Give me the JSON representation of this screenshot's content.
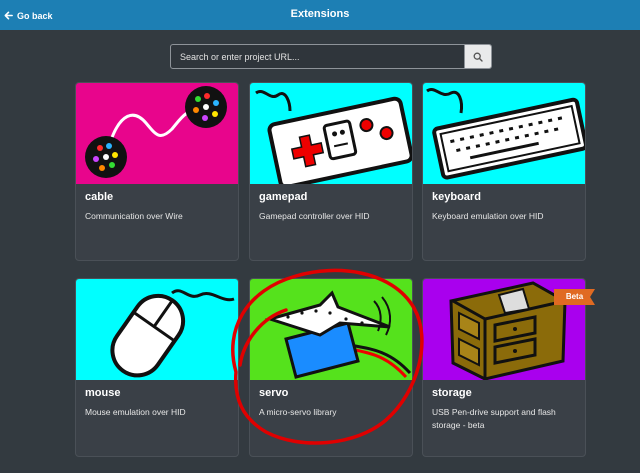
{
  "header": {
    "back_label": "Go back",
    "title": "Extensions"
  },
  "search": {
    "placeholder": "Search or enter project URL..."
  },
  "cards": [
    {
      "name": "cable",
      "description": "Communication over Wire"
    },
    {
      "name": "gamepad",
      "description": "Gamepad controller over HID"
    },
    {
      "name": "keyboard",
      "description": "Keyboard emulation over HID"
    },
    {
      "name": "mouse",
      "description": "Mouse emulation over HID"
    },
    {
      "name": "servo",
      "description": "A micro-servo library"
    },
    {
      "name": "storage",
      "description": "USB Pen-drive support and flash storage - beta",
      "badge": "Beta"
    }
  ],
  "colors": {
    "header": "#1d7fb4",
    "background": "#333a40",
    "card": "#3a4047",
    "cable_bg": "#e8058c",
    "cyan_bg": "#00ffff",
    "servo_bg": "#55e21c",
    "storage_bg": "#a900ee",
    "badge": "#e06a22",
    "annotation": "#e00000"
  },
  "icons": {
    "back": "arrow-left-icon",
    "search": "search-icon"
  }
}
